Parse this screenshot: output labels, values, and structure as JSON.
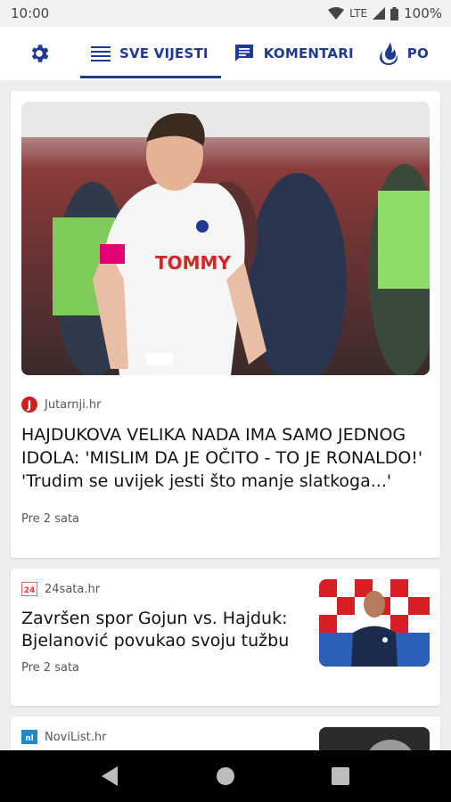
{
  "status_bar": {
    "time": "10:00",
    "network": "LTE",
    "battery": "100%"
  },
  "tabs": [
    {
      "label": "SVE VIJESTI",
      "icon": "list-icon"
    },
    {
      "label": "KOMENTARI",
      "icon": "comment-icon"
    },
    {
      "label": "PO",
      "icon": "fire-icon"
    }
  ],
  "colors": {
    "accent": "#1f3a93",
    "background": "#eeeeee"
  },
  "articles": [
    {
      "source": "Jutarnji.hr",
      "source_icon": "jutarnji-logo",
      "headline": "HAJDUKOVA VELIKA NADA IMA SAMO JEDNOG IDOLA: 'MISLIM DA JE OČITO - TO JE RONALDO!' 'Trudim se uvijek jesti što manje slatkoga...'",
      "time": "Pre 2 sata",
      "sponsor_text": "TOMMY"
    },
    {
      "source": "24sata.hr",
      "source_icon": "24sata-logo",
      "headline": "Završen spor Gojun vs. Hajduk: Bjelanović povukao svoju tužbu",
      "time": "Pre 2 sata"
    },
    {
      "source": "NoviList.hr",
      "source_icon": "novilist-logo"
    }
  ]
}
